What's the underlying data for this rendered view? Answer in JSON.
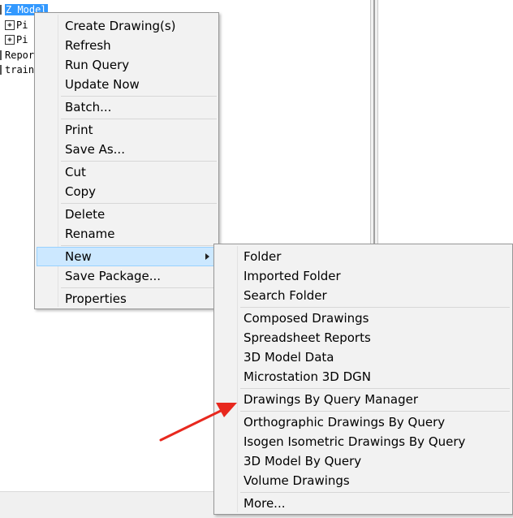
{
  "tree": {
    "rows": [
      {
        "label": "Z Model",
        "selected": true
      },
      {
        "label": "Pi",
        "selected": false
      },
      {
        "label": "Pi",
        "selected": false
      },
      {
        "label": "Repor",
        "selected": false
      },
      {
        "label": "train",
        "selected": false
      }
    ]
  },
  "context_menu": {
    "items": [
      "Create Drawing(s)",
      "Refresh",
      "Run Query",
      "Update Now",
      "Batch...",
      "Print",
      "Save As...",
      "Cut",
      "Copy",
      "Delete",
      "Rename",
      "New",
      "Save Package...",
      "Properties"
    ],
    "highlighted": "New"
  },
  "submenu": {
    "items": [
      "Folder",
      "Imported Folder",
      "Search Folder",
      "Composed Drawings",
      "Spreadsheet Reports",
      "3D Model Data",
      "Microstation 3D DGN",
      "Drawings By Query Manager",
      "Orthographic Drawings By Query",
      "Isogen Isometric Drawings By Query",
      "3D Model By Query",
      "Volume Drawings",
      "More..."
    ]
  },
  "annotation": {
    "color": "#e8281e",
    "points_to": "Drawings By Query Manager"
  },
  "colors": {
    "menu_bg": "#f2f2f2",
    "highlight": "#cce8ff",
    "selection": "#3399ff"
  }
}
